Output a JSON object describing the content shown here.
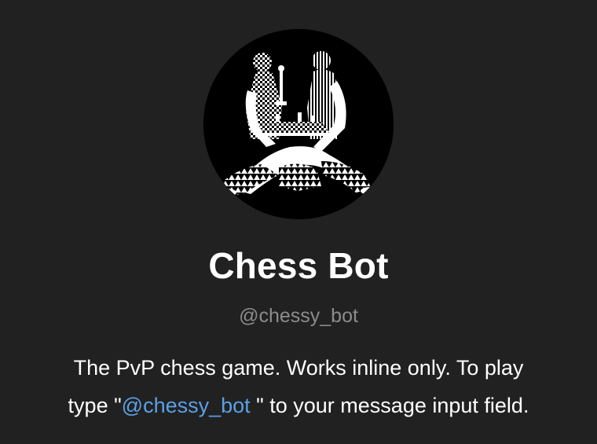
{
  "profile": {
    "name": "Chess Bot",
    "username": "@chessy_bot",
    "about": {
      "line1": "The PvP chess game. Works inline only. To play",
      "line2_prefix": "type \"",
      "mention": "@chessy_bot",
      "line2_suffix": " \" to your message input field."
    },
    "avatar_icon": "chess-players-logo",
    "colors": {
      "background": "#212121",
      "name_text": "#ffffff",
      "username_text": "#8c8c8c",
      "mention_link": "#5aa1e6"
    }
  }
}
